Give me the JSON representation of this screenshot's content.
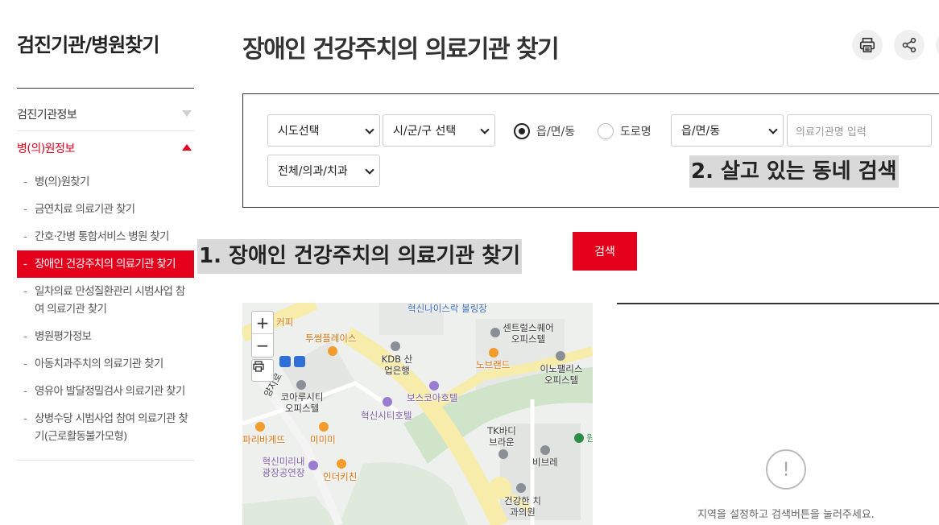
{
  "sidebar": {
    "title": "검진기관/병원찾기",
    "menu": [
      {
        "label": "검진기관정보"
      },
      {
        "label": "병(의)원정보"
      }
    ],
    "submenu": [
      {
        "label": "병(의)원찾기"
      },
      {
        "label": "금연치료 의료기관 찾기"
      },
      {
        "label": "간호·간병 통합서비스 병원 찾기"
      },
      {
        "label": "장애인 건강주치의 의료기관 찾기"
      },
      {
        "label": "일차의료 만성질환관리 시범사업 참여 의료기관 찾기"
      },
      {
        "label": "병원평가정보"
      },
      {
        "label": "아동치과주치의 의료기관 찾기"
      },
      {
        "label": "영유아 발달정밀검사 의료기관 찾기"
      },
      {
        "label": "상병수당 시범사업 참여 의료기관 찾기(근로활동불가모형)"
      }
    ]
  },
  "main": {
    "title": "장애인 건강주치의 의료기관 찾기",
    "icons": {
      "print": "print-icon",
      "share": "share-icon"
    }
  },
  "search": {
    "sido": "시도선택",
    "sigungu": "시/군/구 선택",
    "radio_1": "읍/면/동",
    "radio_2": "도로명",
    "dong": "읍/면/동",
    "institution_placeholder": "의료기관명 입력",
    "type": "전체/의과/치과",
    "button": "검색"
  },
  "annotations": {
    "step1": "1. 장애인 건강주치의 의료기관 찾기",
    "step2": "2. 살고 있는 동네 검색"
  },
  "map": {
    "labels": {
      "bowling": "혁신나이스락 볼링장",
      "coffee": "커피",
      "twosome": "투썸플레이스",
      "kdb": "KDB 산업은행",
      "central": "센트럴스퀘어 오피스텔",
      "noblend": "노브랜드",
      "inopalace": "이노팰리스 오피스텔",
      "road": "양지로",
      "koaru": "코아루시티 오피스텔",
      "boss": "보스코아호텔",
      "hyeoksin_hotel": "혁신시티호텔",
      "paris": "파리바게뜨",
      "mimimi": "미미미",
      "tk": "TK바디 브라운",
      "bibre": "비브레",
      "won": "원",
      "playground": "혁신미리내 광장공연장",
      "indercheen": "인더키친",
      "dental": "건강한 치과의원"
    }
  },
  "results": {
    "empty_icon": "!",
    "empty_message": "지역을 설정하고 검색버튼을 눌러주세요."
  }
}
